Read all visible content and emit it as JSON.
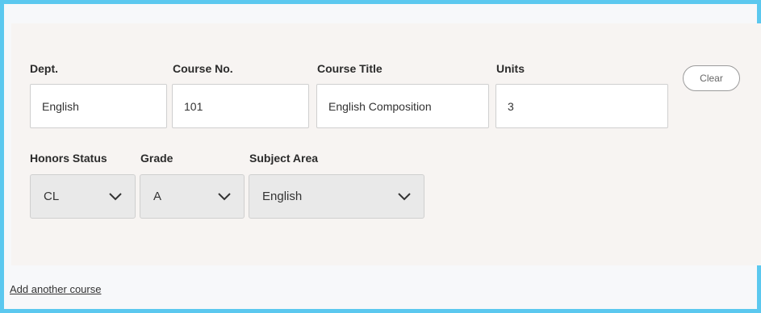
{
  "course_form": {
    "labels": {
      "dept": "Dept.",
      "course_no": "Course No.",
      "course_title": "Course Title",
      "units": "Units",
      "honors_status": "Honors Status",
      "grade": "Grade",
      "subject_area": "Subject Area"
    },
    "values": {
      "dept": "English",
      "course_no": "101",
      "course_title": "English Composition",
      "units": "3",
      "honors_status": "CL",
      "grade": "A",
      "subject_area": "English"
    },
    "clear_label": "Clear"
  },
  "add_course_link": "Add another course",
  "icons": {
    "dropdown": "chevron-down-icon"
  },
  "colors": {
    "frame_border": "#5bc8ef",
    "card_background": "#f7f4f2",
    "select_background": "#e9e9e9"
  }
}
